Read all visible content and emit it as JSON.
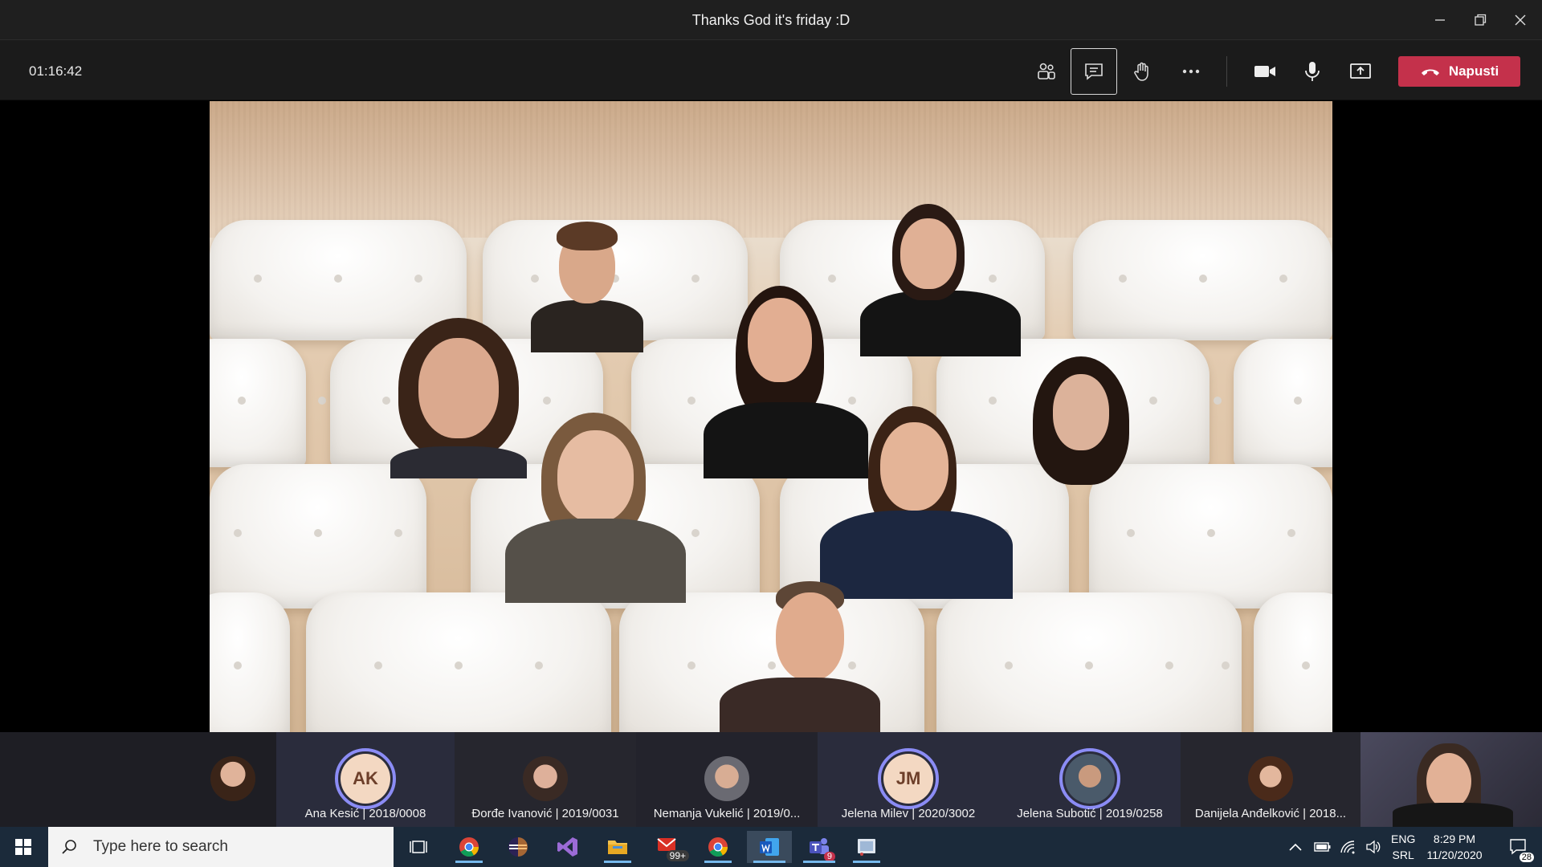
{
  "window": {
    "title": "Thanks God it's friday :D"
  },
  "toolbar": {
    "timer": "01:16:42",
    "leave_label": "Napusti"
  },
  "participants": [
    {
      "name": ""
    },
    {
      "name": "Ana Kesić | 2018/0008",
      "initials": "AK"
    },
    {
      "name": "Đorđe Ivanović | 2019/0031"
    },
    {
      "name": "Nemanja Vukelić | 2019/0..."
    },
    {
      "name": "Jelena Milev | 2020/3002",
      "initials": "JM"
    },
    {
      "name": "Jelena Subotić | 2019/0258"
    },
    {
      "name": "Danijela Anđelković | 2018..."
    }
  ],
  "taskbar": {
    "search_placeholder": "Type here to search",
    "mail_badge": "99+",
    "teams_badge": "9",
    "language": "ENG",
    "layout": "SRL",
    "time": "8:29 PM",
    "date": "11/20/2020",
    "notifications_count": "28"
  },
  "colors": {
    "leave": "#c4314b",
    "ring": "#8b8cf5",
    "taskbar": "#1b2a3a"
  }
}
